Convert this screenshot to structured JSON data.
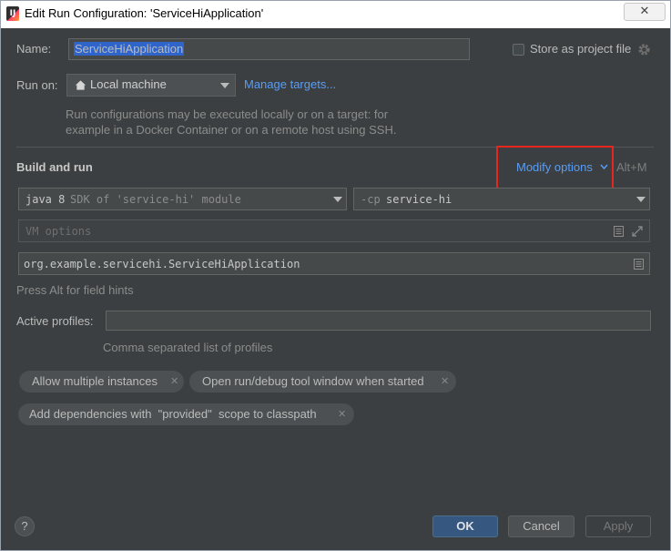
{
  "window": {
    "title": "Edit Run Configuration: 'ServiceHiApplication'",
    "close_glyph": "✕",
    "app_icon": "intellij-icon"
  },
  "name": {
    "label": "Name:",
    "value": "ServiceHiApplication"
  },
  "store": {
    "label": "Store as project file",
    "checked": false,
    "icon": "gear-icon"
  },
  "run_on": {
    "label": "Run on:",
    "value": "Local machine",
    "icon": "home-icon",
    "manage_link": "Manage targets...",
    "hint": [
      "Run configurations may be executed locally or on a target: for",
      "example in a Docker Container or on a remote host using SSH."
    ]
  },
  "build_run": {
    "heading": "Build and run",
    "modify_options": "Modify options",
    "modify_shortcut": "Alt+M",
    "sdk_prefix": "java 8",
    "sdk_suffix": "SDK of 'service-hi' module",
    "cp_prefix": "-cp",
    "cp_value": "service-hi",
    "vm_placeholder": "VM options",
    "main_class": "org.example.servicehi.ServiceHiApplication",
    "field_hint": "Press Alt for field hints"
  },
  "profiles": {
    "label": "Active profiles:",
    "value": "",
    "hint": "Comma separated list of profiles"
  },
  "chips": [
    {
      "label": "Allow multiple instances"
    },
    {
      "label": "Open run/debug tool window when started"
    },
    {
      "label": "Add dependencies with  \"provided\"  scope to classpath"
    }
  ],
  "chip_remove_glyph": "✕",
  "buttons": {
    "help": "?",
    "ok": "OK",
    "cancel": "Cancel",
    "apply": "Apply"
  },
  "colors": {
    "background": "#3c3f41",
    "accent_blue": "#589df6",
    "ok_button": "#365880",
    "highlight_border": "#e8261d"
  }
}
